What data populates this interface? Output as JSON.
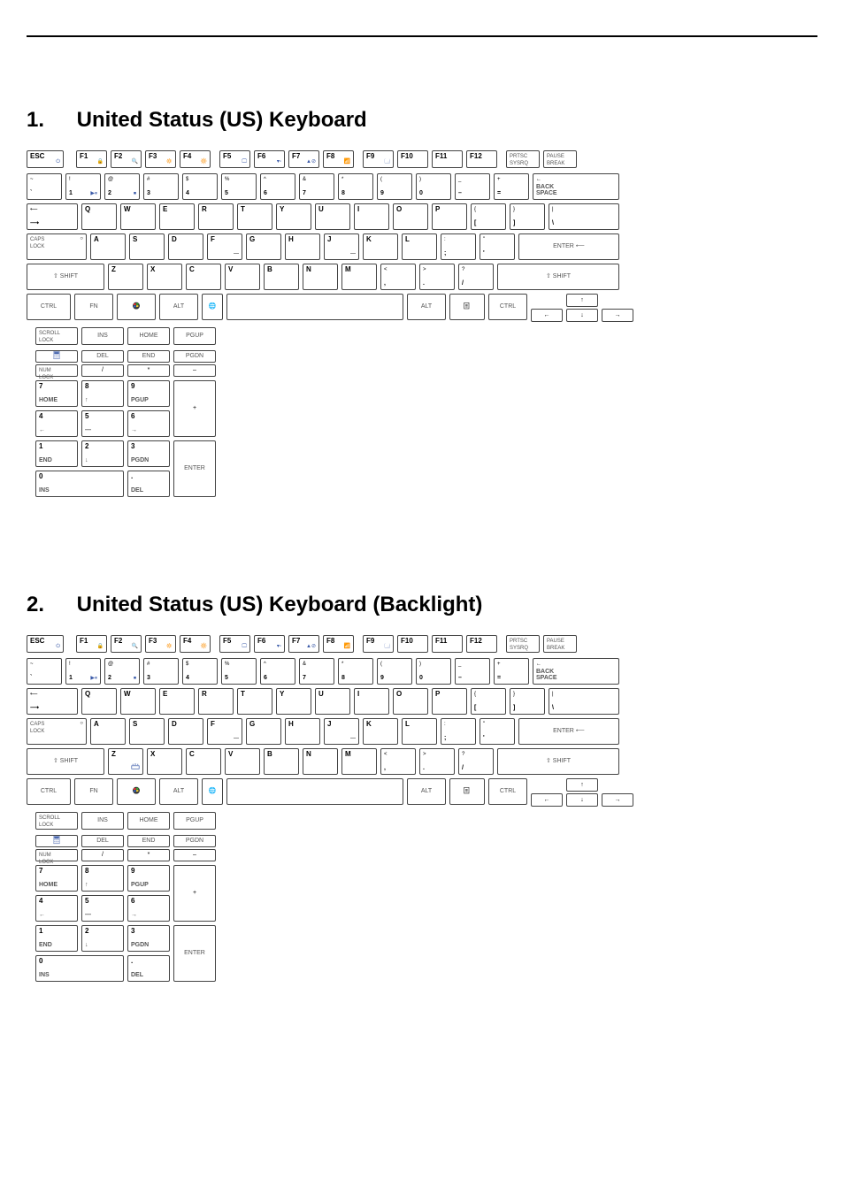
{
  "heading1": {
    "num": "1.",
    "title": "United Status (US) Keyboard"
  },
  "heading2": {
    "num": "2.",
    "title": "United Status (US) Keyboard (Backlight)"
  },
  "keys": {
    "esc": "ESC",
    "f1": "F1",
    "f2": "F2",
    "f3": "F3",
    "f4": "F4",
    "f5": "F5",
    "f6": "F6",
    "f7": "F7",
    "f8": "F8",
    "f9": "F9",
    "f10": "F10",
    "f11": "F11",
    "f12": "F12",
    "prtsc": "PRTSC\nSYSRQ",
    "pause": "PAUSE\nBREAK",
    "tilde_top": "~",
    "tilde_bot": "`",
    "n1_top": "!",
    "n1_bot": "1",
    "n2_top": "@",
    "n2_bot": "2",
    "n3_top": "#",
    "n3_bot": "3",
    "n4_top": "$",
    "n4_bot": "4",
    "n5_top": "%",
    "n5_bot": "5",
    "n6_top": "^",
    "n6_bot": "6",
    "n7_top": "&",
    "n7_bot": "7",
    "n8_top": "*",
    "n8_bot": "8",
    "n9_top": "(",
    "n9_bot": "9",
    "n0_top": ")",
    "n0_bot": "0",
    "minus_top": "_",
    "minus_bot": "–",
    "equals_top": "+",
    "equals_bot": "=",
    "backspace": "BACK\nSPACE",
    "tab_top": "⟵",
    "tab_bot": "⟶",
    "q": "Q",
    "w": "W",
    "e": "E",
    "r": "R",
    "t": "T",
    "y": "Y",
    "u": "U",
    "i": "I",
    "o": "O",
    "p": "P",
    "lbracket_top": "{",
    "lbracket_bot": "[",
    "rbracket_top": "}",
    "rbracket_bot": "]",
    "bslash_top": "|",
    "bslash_bot": "\\",
    "caps": "CAPS\nLOCK",
    "a": "A",
    "s": "S",
    "d": "D",
    "f": "F",
    "g": "G",
    "h": "H",
    "j": "J",
    "k": "K",
    "l": "L",
    "semi_top": ":",
    "semi_bot": ";",
    "quote_top": "\"",
    "quote_bot": "'",
    "enter": "ENTER ⟵",
    "shift": "⇧ SHIFT",
    "z": "Z",
    "x": "X",
    "c": "C",
    "v": "V",
    "b": "B",
    "n": "N",
    "m": "M",
    "comma_top": "<",
    "comma_bot": ",",
    "period_top": ">",
    "period_bot": ".",
    "slash_top": "?",
    "slash_bot": "/",
    "ctrl": "CTRL",
    "fn": "FN",
    "alt": "ALT",
    "up": "↑",
    "down": "↓",
    "left": "←",
    "right": "→",
    "scroll": "SCROLL\nLOCK",
    "ins": "INS",
    "home": "HOME",
    "pgup": "PGUP",
    "del": "DEL",
    "end": "END",
    "pgdn": "PGDN",
    "numlock": "NUM\nLOCK",
    "npslash": "/",
    "npstar": "*",
    "npminus": "–",
    "np7": "7",
    "np8": "8",
    "np9": "9",
    "np7sub": "HOME",
    "np8sub": "↑",
    "np9sub": "PGUP",
    "npplus": "+",
    "np4": "4",
    "np5": "5",
    "np6": "6",
    "np4sub": "←",
    "np5sub": "—",
    "np6sub": "→",
    "np1": "1",
    "np2": "2",
    "np3": "3",
    "np1sub": "END",
    "np2sub": "↓",
    "np3sub": "PGDN",
    "npenter": "ENTER",
    "np0": "0",
    "np0sub": "INS",
    "npdot": ".",
    "npdotsub": "DEL"
  }
}
